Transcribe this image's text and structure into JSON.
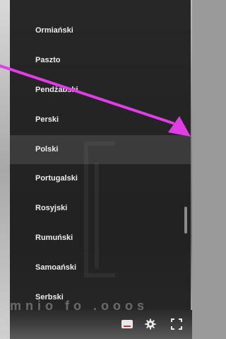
{
  "languages": [
    "Ormiański",
    "Paszto",
    "Pendżabski",
    "Perski",
    "Polski",
    "Portugalski",
    "Rosyjski",
    "Rumuński",
    "Samoański",
    "Serbski"
  ],
  "selected_language": "Polski",
  "ghost_caption": "mnio fo .ooos",
  "icons": {
    "captions": "subtitles-icon",
    "settings": "gear-icon",
    "fullscreen": "fullscreen-icon",
    "annotation": "arrow-annotation"
  },
  "colors": {
    "menu_bg": "#1c1c1c",
    "menu_text": "#ececec",
    "arrow": "#e23ce6",
    "caption_accent": "#c0392b"
  }
}
